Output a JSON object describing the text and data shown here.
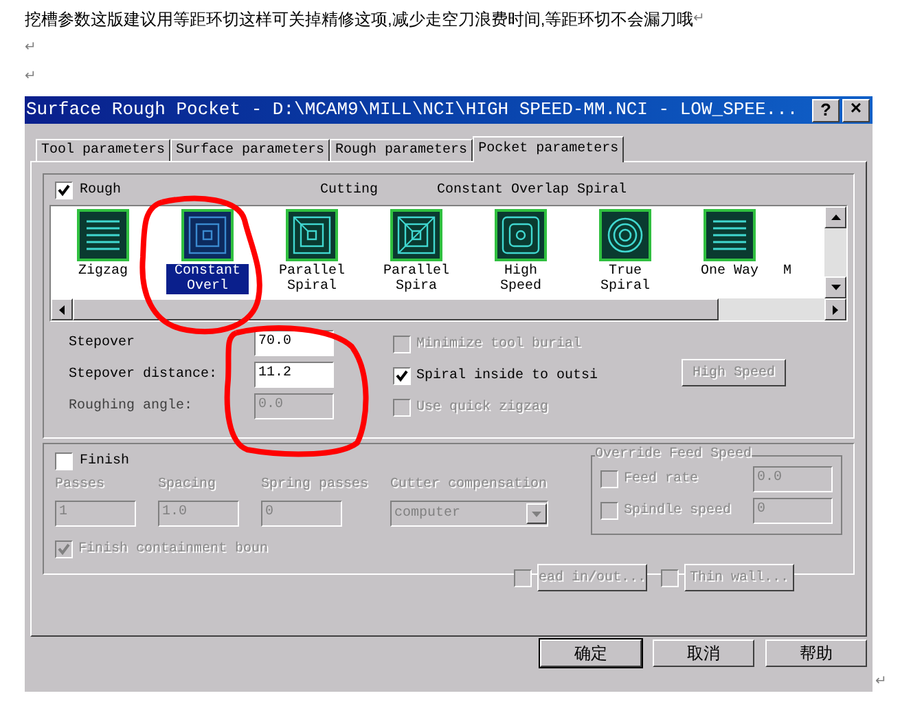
{
  "document": {
    "paragraphs": [
      {
        "text": "挖槽参数这版建议用等距环切这样可关掉精修这项,减少走空刀浪费时间,等距环切不会漏刀哦",
        "mark": "↵"
      },
      {
        "mark": "↵"
      },
      {
        "mark": "↵"
      }
    ],
    "end_mark": "↵"
  },
  "window": {
    "title": "Surface Rough Pocket - D:\\MCAM9\\MILL\\NCI\\HIGH SPEED-MM.NCI - LOW_SPEE...",
    "help": "?",
    "close": "×"
  },
  "tabs": [
    {
      "label": "Tool parameters",
      "selected": false
    },
    {
      "label": "Surface parameters",
      "selected": false
    },
    {
      "label": "Rough parameters",
      "selected": false
    },
    {
      "label": "Pocket parameters",
      "selected": true
    }
  ],
  "rough": {
    "label": "Rough",
    "checked": true,
    "cutting_label": "Cutting",
    "cutting_value": "Constant Overlap Spiral",
    "patterns": [
      {
        "label": "Zigzag",
        "kind": "lines",
        "selected": false
      },
      {
        "label": "Constant Overl",
        "kind": "squares",
        "selected": true
      },
      {
        "label": "Parallel Spiral",
        "kind": "spiral-corner",
        "selected": false
      },
      {
        "label": "Parallel Spira",
        "kind": "spiral-diagonal",
        "selected": false
      },
      {
        "label": "High Speed",
        "kind": "high-speed",
        "selected": false
      },
      {
        "label": "True Spiral",
        "kind": "circles",
        "selected": false
      },
      {
        "label": "One Way",
        "kind": "lines",
        "selected": false
      },
      {
        "label": "M",
        "kind": "partial",
        "selected": false
      }
    ],
    "fields": [
      {
        "label": "Stepover",
        "value": "70.0",
        "disabled": false
      },
      {
        "label": "Stepover distance:",
        "value": "11.2",
        "disabled": false
      },
      {
        "label": "Roughing angle:",
        "value": "0.0",
        "disabled": true
      }
    ],
    "options": [
      {
        "label": "Minimize tool burial",
        "checked": false,
        "disabled": true
      },
      {
        "label": "Spiral inside to outsi",
        "checked": true,
        "disabled": false
      },
      {
        "label": "Use quick zigzag",
        "checked": false,
        "disabled": true
      }
    ],
    "high_speed_button": {
      "label": "High Speed",
      "disabled": true
    }
  },
  "finish": {
    "label": "Finish",
    "checked": false,
    "fields": [
      {
        "label": "Passes",
        "value": "1",
        "kind": "text"
      },
      {
        "label": "Spacing",
        "value": "1.0",
        "kind": "text"
      },
      {
        "label": "Spring passes",
        "value": "0",
        "kind": "text"
      },
      {
        "label": "Cutter compensation",
        "value": "computer",
        "kind": "select"
      }
    ],
    "override": {
      "title": "Override Feed Speed",
      "rows": [
        {
          "label": "Feed rate",
          "checked": false,
          "value": "0.0"
        },
        {
          "label": "Spindle speed",
          "checked": false,
          "value": "0"
        }
      ]
    },
    "containment": {
      "label": "Finish containment boun",
      "checked": true
    },
    "buttons": [
      {
        "label": "ead in/out...",
        "checked": false
      },
      {
        "label": "Thin wall...",
        "checked": false
      }
    ]
  },
  "buttons": [
    {
      "label": "确定",
      "default": true
    },
    {
      "label": "取消",
      "default": false
    },
    {
      "label": "帮助",
      "default": false
    }
  ]
}
